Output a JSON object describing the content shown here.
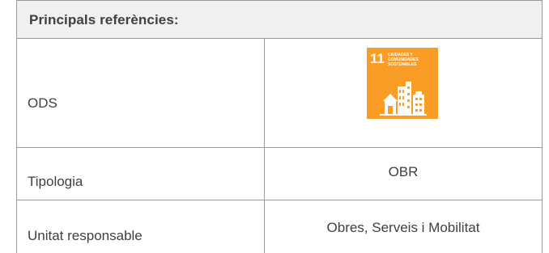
{
  "table": {
    "header": "Principals referències:",
    "rows": [
      {
        "label": "ODS",
        "value": ""
      },
      {
        "label": "Tipologia",
        "value": "OBR"
      },
      {
        "label": "Unitat responsable",
        "value": "Obres, Serveis i Mobilitat"
      }
    ]
  },
  "sdg_badge": {
    "number": "11",
    "text": "CIUDADES Y COMUNIDADES SOSTENIBLES",
    "color": "#f99d26",
    "icon": "city-buildings-icon"
  },
  "colors": {
    "border": "#9a9a9a",
    "header_bg": "#f0f0f0",
    "text": "#404040"
  }
}
